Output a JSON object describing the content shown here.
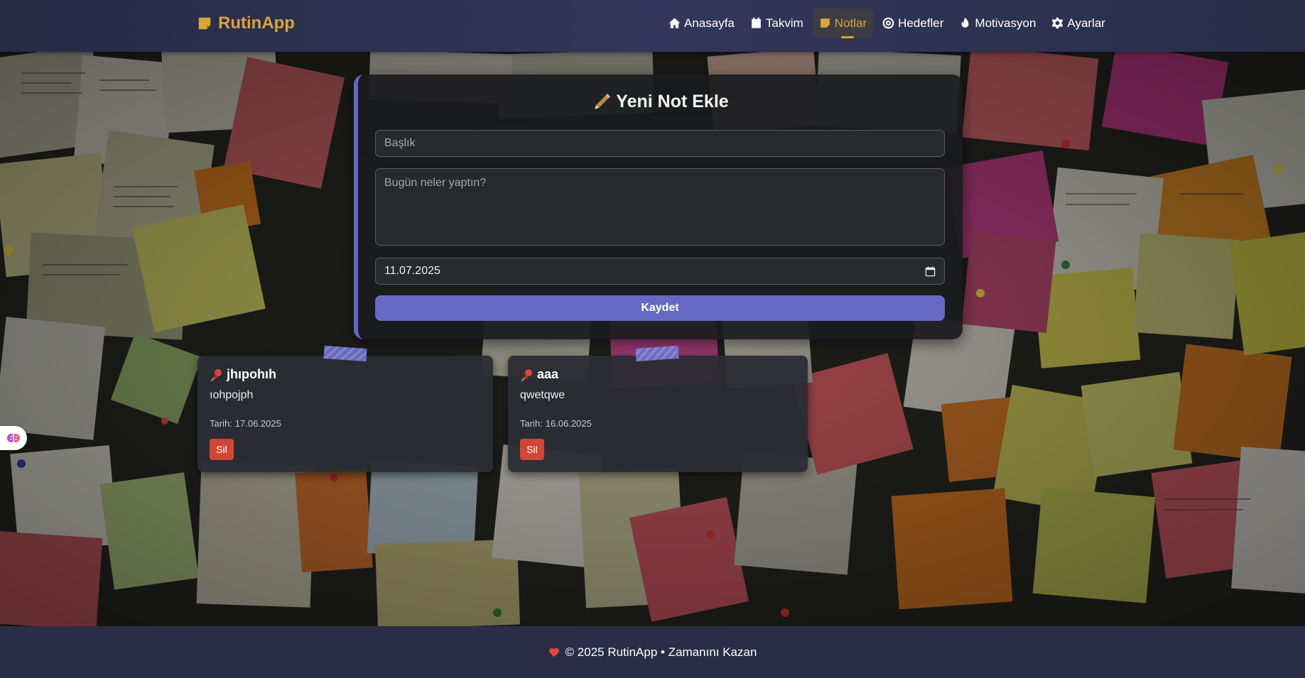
{
  "brand": {
    "name": "RutinApp",
    "icon": "sticky-note-icon",
    "color": "#d9a43a"
  },
  "nav": {
    "items": [
      {
        "label": "Anasayfa",
        "icon": "home-icon"
      },
      {
        "label": "Takvim",
        "icon": "calendar-icon"
      },
      {
        "label": "Notlar",
        "icon": "sticky-note-icon",
        "active": true
      },
      {
        "label": "Hedefler",
        "icon": "target-icon"
      },
      {
        "label": "Motivasyon",
        "icon": "flame-icon"
      },
      {
        "label": "Ayarlar",
        "icon": "gear-icon"
      }
    ]
  },
  "form": {
    "title": "Yeni Not Ekle",
    "title_icon": "pencil-icon",
    "title_placeholder": "Başlık",
    "desc_placeholder": "Bugün neler yaptın?",
    "date_value": "11.07.2025",
    "save_label": "Kaydet",
    "accent": "#6266c4"
  },
  "notes": [
    {
      "title": "jhıpohıh",
      "body": "ıohpojph",
      "date_label": "Tarih:",
      "date": "17.06.2025",
      "delete_label": "Sil"
    },
    {
      "title": "aaa",
      "body": "qwetqwe",
      "date_label": "Tarih:",
      "date": "16.06.2025",
      "delete_label": "Sil"
    }
  ],
  "footer": {
    "text": "© 2025 RutinApp • Zamanını Kazan",
    "icon": "heart-icon"
  },
  "colors": {
    "danger": "#d04636",
    "navbar": "#2b2d47"
  }
}
